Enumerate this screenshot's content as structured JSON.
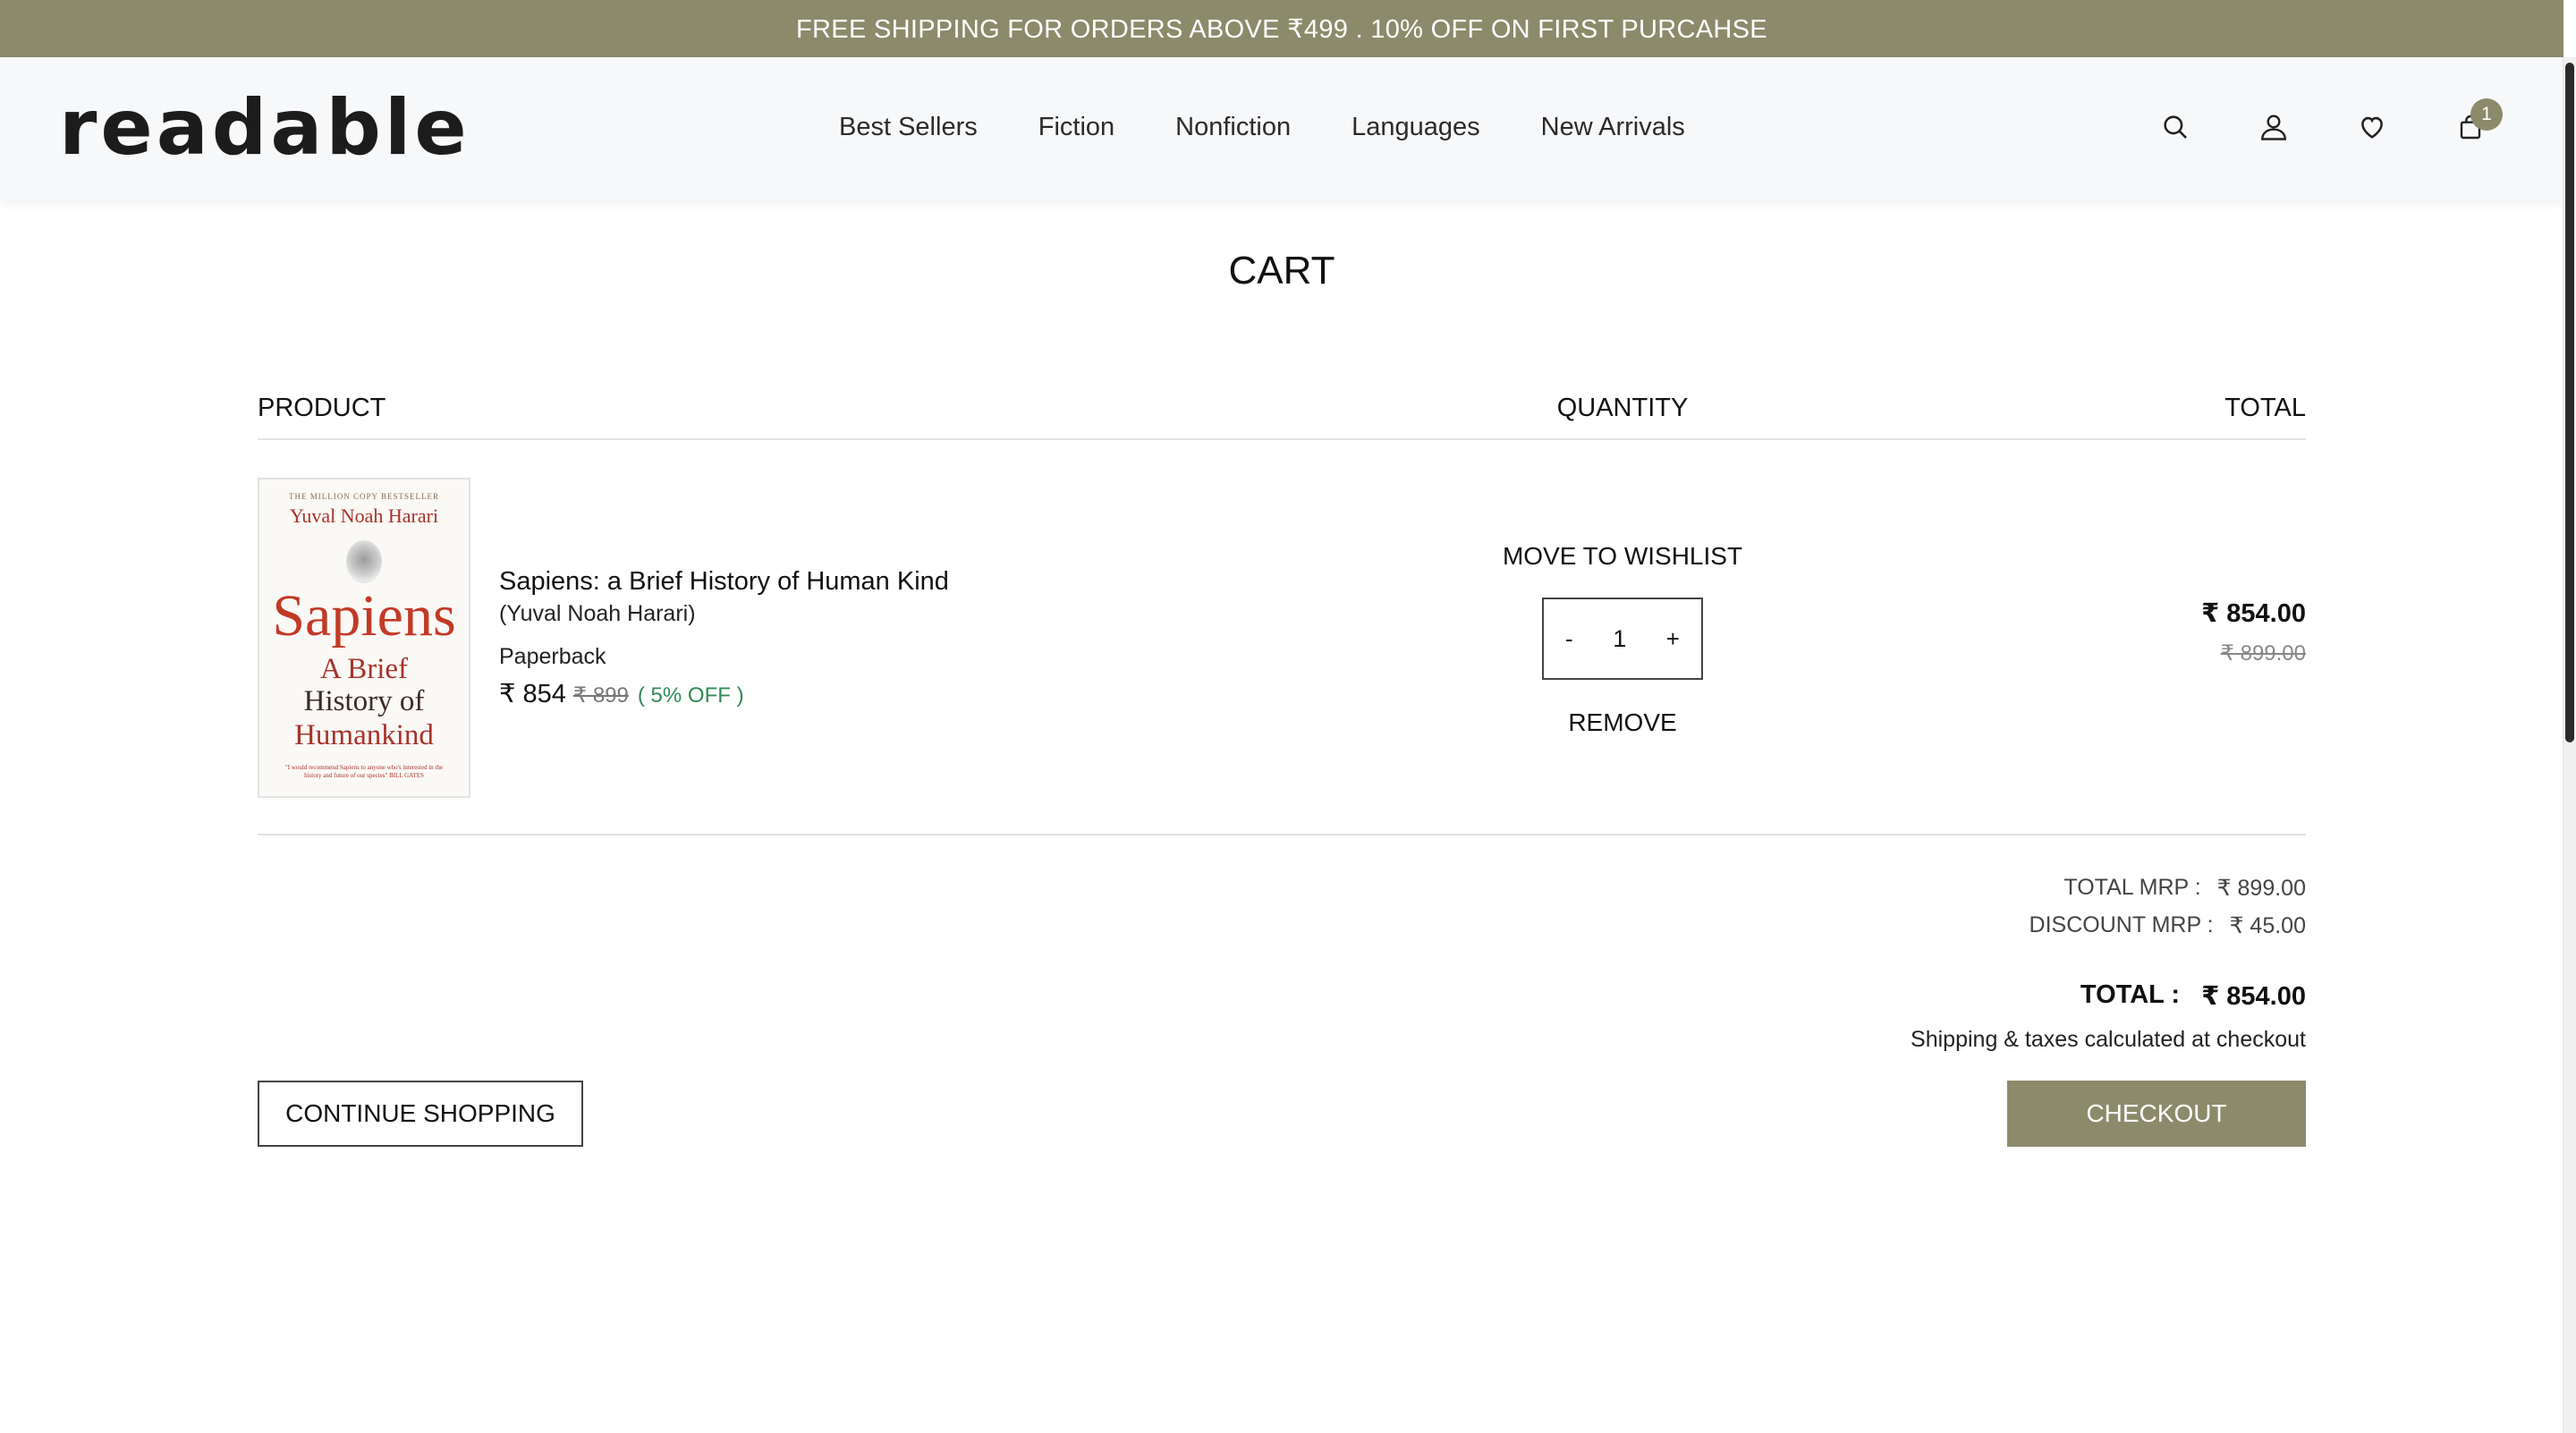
{
  "announcement": "FREE SHIPPING FOR ORDERS ABOVE ₹499 . 10% OFF ON FIRST PURCAHSE",
  "brand": {
    "logo_text": "readable",
    "accent_color": "#8b8a6b"
  },
  "nav": [
    {
      "label": "Best Sellers"
    },
    {
      "label": "Fiction"
    },
    {
      "label": "Nonfiction"
    },
    {
      "label": "Languages"
    },
    {
      "label": "New Arrivals"
    }
  ],
  "header_icons": {
    "search": "search-icon",
    "account": "user-icon",
    "wishlist": "heart-icon",
    "cart": "shopping-bag-icon",
    "cart_count": "1"
  },
  "page_title": "CART",
  "columns": {
    "product": "PRODUCT",
    "quantity": "QUANTITY",
    "total": "TOTAL"
  },
  "item": {
    "cover": {
      "tagline": "THE MILLION COPY BESTSELLER",
      "author": "Yuval Noah Harari",
      "title": "Sapiens",
      "subtitle_1": "A Brief",
      "subtitle_2": "History of",
      "subtitle_3": "Humankind",
      "quote": "\"I would recommend Sapiens to anyone who's interested in the history and future of our species\" BILL GATES"
    },
    "name": "Sapiens: a Brief History of Human Kind",
    "author": "(Yuval Noah Harari)",
    "format": "Paperback",
    "price": "₹ 854",
    "mrp": "₹ 899",
    "discount": "( 5% OFF )",
    "move_to_wishlist": "MOVE TO WISHLIST",
    "quantity": "1",
    "decrement": "-",
    "increment": "+",
    "remove": "REMOVE",
    "line_total": "₹ 854.00",
    "line_mrp": "₹ 899.00"
  },
  "summary": {
    "total_mrp_label": "TOTAL MRP :",
    "total_mrp": "₹ 899.00",
    "discount_label": "DISCOUNT MRP :",
    "discount": "₹ 45.00",
    "total_label": "TOTAL :",
    "total": "₹ 854.00",
    "note": "Shipping & taxes calculated at checkout"
  },
  "actions": {
    "continue": "CONTINUE SHOPPING",
    "checkout": "CHECKOUT"
  }
}
